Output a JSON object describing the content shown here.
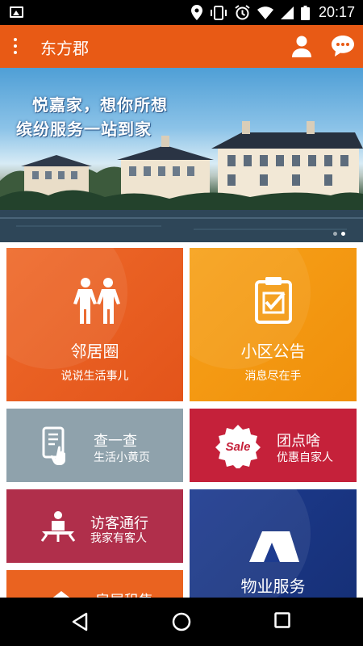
{
  "status_bar": {
    "time": "20:17",
    "icons": [
      "image-icon",
      "location-icon",
      "vibrate-icon",
      "alarm-icon",
      "wifi-icon",
      "signal-icon",
      "battery-icon"
    ]
  },
  "app_bar": {
    "title": "东方郡",
    "background": "#e85a15",
    "icons": [
      "more-vert-icon",
      "user-icon",
      "chat-icon"
    ]
  },
  "banner": {
    "line1": "悦嘉家，想你所想",
    "line2": "缤纷服务一站到家",
    "page_count": 2,
    "active_page": 2
  },
  "tiles": {
    "neighbor": {
      "title": "邻居圈",
      "subtitle": "说说生活事儿",
      "color": "#e85a15",
      "icon": "people-icon"
    },
    "notice": {
      "title": "小区公告",
      "subtitle": "消息尽在手",
      "color": "#f39612",
      "icon": "clipboard-check-icon"
    },
    "search": {
      "title": "查一查",
      "subtitle": "生活小黄页",
      "color": "#8fa2ac",
      "icon": "phone-touch-icon"
    },
    "group": {
      "title": "团点啥",
      "subtitle": "优惠自家人",
      "color": "#c5213a",
      "icon": "sale-badge-icon",
      "badge_text": "Sale"
    },
    "visitor": {
      "title": "访客通行",
      "subtitle": "我家有客人",
      "color": "#b02f4b",
      "icon": "visitor-icon"
    },
    "property": {
      "title": "物业服务",
      "color": "#1d3b8f",
      "icon": "tent-icon"
    },
    "rent": {
      "title": "房屋租售",
      "color": "#ea6320",
      "icon": "house-icon"
    }
  },
  "nav_bar": {
    "icons": [
      "back-icon",
      "home-icon",
      "recents-icon"
    ]
  }
}
